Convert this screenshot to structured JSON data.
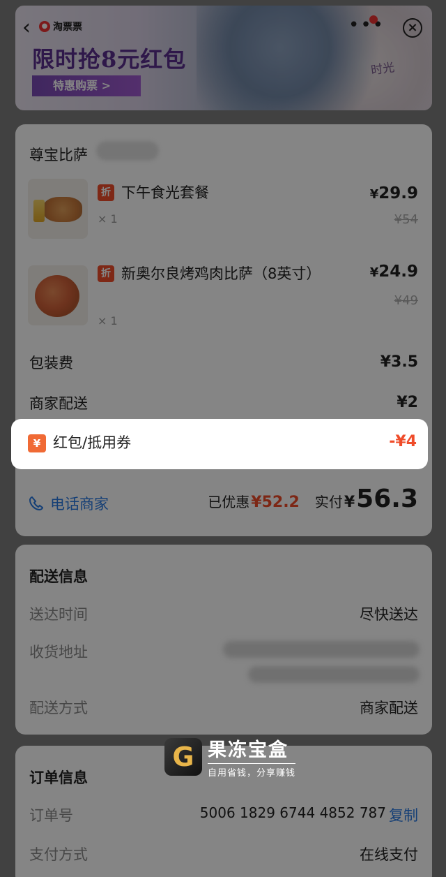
{
  "banner": {
    "app_name": "淘票票",
    "headline": "限时抢8元红包",
    "cta": "特惠购票 >",
    "poster_text": "时光"
  },
  "order": {
    "shop_name": "尊宝比萨",
    "items": [
      {
        "badge": "折",
        "name": "下午食光套餐",
        "qty": "× 1",
        "price_symbol": "¥",
        "price": "29.9",
        "original_price": "¥54"
      },
      {
        "badge": "折",
        "name": "新奥尔良烤鸡肉比萨（8英寸）",
        "qty": "× 1",
        "price_symbol": "¥",
        "price": "24.9",
        "original_price": "¥49"
      }
    ],
    "packaging_label": "包装费",
    "packaging_value": "¥3.5",
    "delivery_label": "商家配送",
    "delivery_value": "¥2",
    "coupon_icon": "¥",
    "coupon_label": "红包/抵用券",
    "coupon_value": "-¥4",
    "call_label": "电话商家",
    "discount_label": "已优惠",
    "discount_value": "¥52.2",
    "paid_label": "实付",
    "paid_symbol": "¥",
    "paid_value": "56.3"
  },
  "delivery_info": {
    "title": "配送信息",
    "time_label": "送达时间",
    "time_value": "尽快送达",
    "address_label": "收货地址",
    "method_label": "配送方式",
    "method_value": "商家配送"
  },
  "order_info": {
    "title": "订单信息",
    "number_label": "订单号",
    "number_value": "5006 1829 6744 4852 787",
    "copy_label": "复制",
    "payment_label": "支付方式",
    "payment_value": "在线支付"
  },
  "watermark": {
    "logo_letter": "G",
    "title": "果冻宝盒",
    "slogan": "自用省钱，分享赚钱"
  },
  "colors": {
    "accent_red": "#ef4c2a",
    "link_blue": "#2a7ae2",
    "badge_red": "#f14e2b"
  }
}
